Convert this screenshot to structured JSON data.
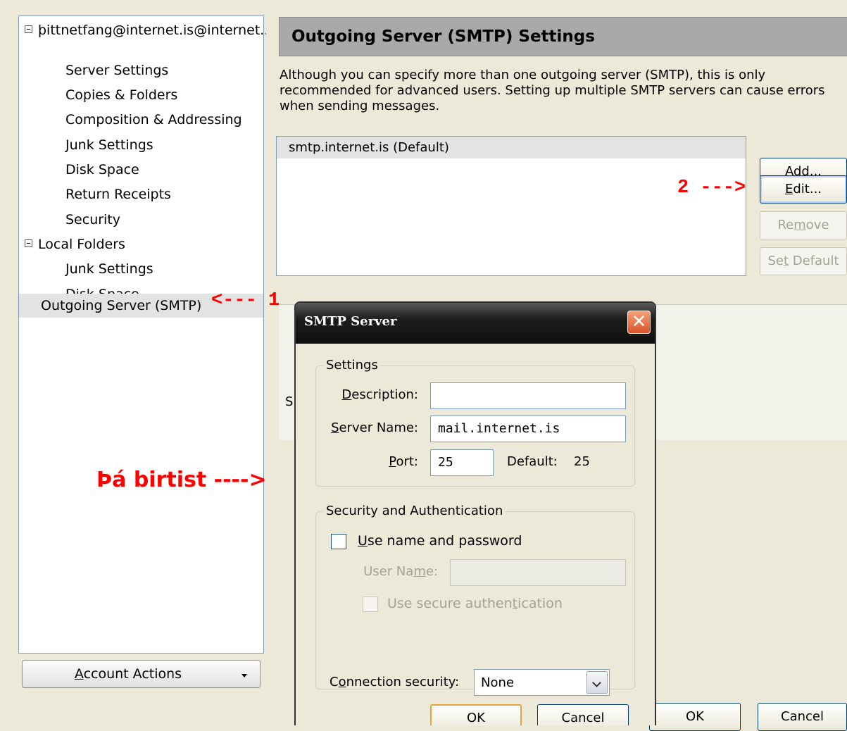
{
  "tree": {
    "items": [
      {
        "label": "þittnetfang@internet.is@internet...",
        "expander": true
      },
      {
        "label": "Server Settings"
      },
      {
        "label": "Copies & Folders"
      },
      {
        "label": "Composition & Addressing"
      },
      {
        "label": "Junk Settings"
      },
      {
        "label": "Disk Space"
      },
      {
        "label": "Return Receipts"
      },
      {
        "label": "Security"
      },
      {
        "label": "Local Folders",
        "expander": true
      },
      {
        "label": "Junk Settings"
      },
      {
        "label": "Disk Space"
      },
      {
        "label": "Outgoing Server (SMTP)",
        "selected": true
      }
    ],
    "account_actions": {
      "pre": "",
      "u": "A",
      "post": "ccount Actions"
    }
  },
  "panel": {
    "heading": "Outgoing Server (SMTP) Settings",
    "description": "Although you can specify more than one outgoing server (SMTP), this is only recommended for advanced users. Setting up multiple SMTP servers can cause errors when sending messages.",
    "servers": [
      "smtp.internet.is (Default)"
    ],
    "details_label": "S",
    "buttons": {
      "add": {
        "pre": "A",
        "u": "d",
        "post": "d..."
      },
      "edit": {
        "pre": "",
        "u": "E",
        "post": "dit..."
      },
      "remove": {
        "pre": "Re",
        "u": "m",
        "post": "ove"
      },
      "set_default": {
        "pre": "Se",
        "u": "t",
        "post": " Default"
      }
    },
    "ok": "OK",
    "cancel": "Cancel"
  },
  "annotations": {
    "arrow1": "<--- 1",
    "arrow2": "2 --->",
    "then_appears": "Þá birtist ---->"
  },
  "dialog": {
    "title": "SMTP Server",
    "close_glyph": "✕",
    "settings_legend": "Settings",
    "description_label": {
      "pre": "",
      "u": "D",
      "post": "escription:"
    },
    "description_value": "",
    "server_name_label": {
      "pre": "",
      "u": "S",
      "post": "erver Name:"
    },
    "server_name_value": "mail.internet.is",
    "port_label": {
      "pre": "",
      "u": "P",
      "post": "ort:"
    },
    "port_value": "25",
    "default_port_label": "Default:",
    "default_port_value": "25",
    "security_legend": "Security and Authentication",
    "use_name_password": {
      "pre": "",
      "u": "U",
      "post": "se name and password"
    },
    "user_name_label": {
      "pre": "User Na",
      "u": "m",
      "post": "e:"
    },
    "user_name_value": "",
    "use_secure_auth": {
      "pre": "Use secure authen",
      "u": "t",
      "post": "ication"
    },
    "connection_security_label": {
      "pre": "C",
      "u": "o",
      "post": "nnection security:"
    },
    "connection_security_value": "None",
    "ok": "OK",
    "cancel": "Cancel"
  },
  "colors": {
    "annotation": "#ff0000",
    "selection": "#e3e3e3",
    "heading_bg": "#a9a9a9"
  }
}
